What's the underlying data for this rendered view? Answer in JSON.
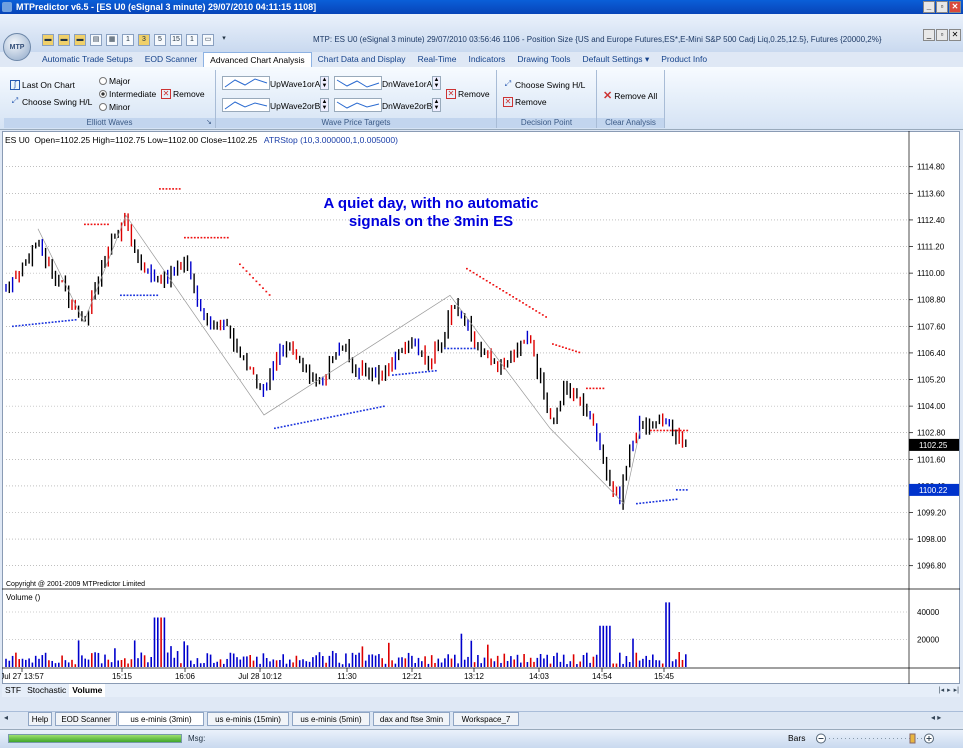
{
  "window": {
    "title": "MTPredictor v6.5 - [ES U0 (eSignal 3 minute) 29/07/2010 04:11:15 1108]",
    "minimize": "_",
    "restore": "▫",
    "close": "✕"
  },
  "app": {
    "orb_label": "MTP",
    "quick_access": [
      "1",
      "3",
      "5",
      "15",
      "1"
    ],
    "info": "MTP: ES U0 (eSignal 3 minute) 29/07/2010 03:56:46 1106 - Position Size {US and Europe Futures,ES*,E-Mini S&P 500 Cadj Liq,0.25,12.5}, Futures {20000,2%}"
  },
  "ribbon_tabs": [
    "Automatic Trade Setups",
    "EOD Scanner",
    "Advanced Chart Analysis",
    "Chart Data and Display",
    "Real-Time",
    "Indicators",
    "Drawing Tools",
    "Default Settings",
    "Product Info"
  ],
  "ribbon": {
    "elliott": {
      "last_on_chart": "Last On Chart",
      "choose_swing": "Choose Swing H/L",
      "major": "Major",
      "intermediate": "Intermediate",
      "minor": "Minor",
      "remove": "Remove",
      "label": "Elliott Waves"
    },
    "wave_targets": {
      "up1": "UpWave1orA",
      "up2": "UpWave2orB",
      "dn1": "DnWave1orA",
      "dn2": "DnWave2orB",
      "remove": "Remove",
      "label": "Wave Price Targets"
    },
    "decision": {
      "choose_swing": "Choose Swing H/L",
      "remove": "Remove",
      "label": "Decision Point"
    },
    "clear": {
      "remove_all": "Remove All",
      "label": "Clear Analysis"
    }
  },
  "chart": {
    "header_symbol": "ES U0",
    "header_ohlc": "Open=1102.25  High=1102.75  Low=1102.00  Close=1102.25",
    "header_indicator": "ATRStop (10,3.000000,1,0.005000)",
    "annotation_line1": "A quiet day, with no automatic",
    "annotation_line2": "signals on the 3min ES",
    "copyright": "Copyright @ 2001-2009 MTPredictor Limited",
    "volume_label": "Volume ()",
    "current_price_label": "1102.25",
    "stop_price_label": "1100.22",
    "colors": {
      "up": "#dd0000",
      "down": "#0000cc",
      "neutral": "#000000",
      "price_tag": "#000000",
      "stop_tag": "#0033cc"
    }
  },
  "chart_data": {
    "type": "candlestick",
    "price_axis_ticks": [
      "1114.80",
      "1113.60",
      "1112.40",
      "1111.20",
      "1110.00",
      "1108.80",
      "1107.60",
      "1106.40",
      "1105.20",
      "1104.00",
      "1102.80",
      "1101.60",
      "1100.40",
      "1099.20",
      "1098.00",
      "1096.80"
    ],
    "volume_axis_ticks": [
      "40000",
      "20000"
    ],
    "time_axis_ticks": [
      "Jul 27 13:57",
      "15:15",
      "16:06",
      "Jul 28 10:12",
      "11:30",
      "12:21",
      "13:12",
      "14:03",
      "14:54",
      "15:45"
    ],
    "ylim": [
      1096.2,
      1115.6
    ],
    "price_path": [
      [
        0,
        1109.2
      ],
      [
        10,
        1109.8
      ],
      [
        22,
        1110.5
      ],
      [
        32,
        1111.4
      ],
      [
        42,
        1110.6
      ],
      [
        55,
        1109.6
      ],
      [
        70,
        1108.6
      ],
      [
        80,
        1107.8
      ],
      [
        95,
        1109.8
      ],
      [
        110,
        1111.6
      ],
      [
        122,
        1112.4
      ],
      [
        132,
        1110.8
      ],
      [
        145,
        1109.8
      ],
      [
        160,
        1109.6
      ],
      [
        175,
        1110.6
      ],
      [
        185,
        1110.2
      ],
      [
        195,
        1108.4
      ],
      [
        208,
        1107.6
      ],
      [
        220,
        1108.0
      ],
      [
        232,
        1106.6
      ],
      [
        246,
        1105.6
      ],
      [
        260,
        1104.6
      ],
      [
        272,
        1106.2
      ],
      [
        286,
        1106.6
      ],
      [
        300,
        1106.0
      ],
      [
        312,
        1104.8
      ],
      [
        325,
        1105.8
      ],
      [
        338,
        1106.8
      ],
      [
        352,
        1105.6
      ],
      [
        368,
        1105.6
      ],
      [
        382,
        1105.4
      ],
      [
        396,
        1106.6
      ],
      [
        410,
        1106.8
      ],
      [
        422,
        1106.0
      ],
      [
        436,
        1106.6
      ],
      [
        448,
        1108.6
      ],
      [
        460,
        1108.0
      ],
      [
        472,
        1106.6
      ],
      [
        486,
        1106.0
      ],
      [
        500,
        1105.6
      ],
      [
        512,
        1106.6
      ],
      [
        526,
        1107.2
      ],
      [
        538,
        1104.8
      ],
      [
        548,
        1103.2
      ],
      [
        560,
        1104.8
      ],
      [
        572,
        1104.4
      ],
      [
        584,
        1103.6
      ],
      [
        596,
        1102.4
      ],
      [
        606,
        1100.6
      ],
      [
        616,
        1099.8
      ],
      [
        626,
        1101.8
      ],
      [
        636,
        1103.4
      ],
      [
        648,
        1103.0
      ],
      [
        660,
        1103.4
      ],
      [
        672,
        1102.6
      ],
      [
        683,
        1102.25
      ]
    ],
    "atr_stop_segments": [
      {
        "side": "below",
        "from": [
          8,
          1107.6
        ],
        "to": [
          72,
          1107.9
        ]
      },
      {
        "side": "above",
        "from": [
          80,
          1112.2
        ],
        "to": [
          105,
          1112.2
        ]
      },
      {
        "side": "below",
        "from": [
          116,
          1109.0
        ],
        "to": [
          155,
          1109.0
        ]
      },
      {
        "side": "above",
        "from": [
          155,
          1113.8
        ],
        "to": [
          176,
          1113.8
        ]
      },
      {
        "side": "above",
        "from": [
          180,
          1111.6
        ],
        "to": [
          226,
          1111.6
        ]
      },
      {
        "side": "above",
        "from": [
          235,
          1110.4
        ],
        "to": [
          265,
          1109.0
        ]
      },
      {
        "side": "below",
        "from": [
          270,
          1103.0
        ],
        "to": [
          380,
          1104.0
        ]
      },
      {
        "side": "below",
        "from": [
          388,
          1105.4
        ],
        "to": [
          432,
          1105.6
        ]
      },
      {
        "side": "below",
        "from": [
          440,
          1106.6
        ],
        "to": [
          470,
          1106.6
        ]
      },
      {
        "side": "above",
        "from": [
          462,
          1110.2
        ],
        "to": [
          542,
          1108.0
        ]
      },
      {
        "side": "above",
        "from": [
          548,
          1106.8
        ],
        "to": [
          576,
          1106.4
        ]
      },
      {
        "side": "above",
        "from": [
          582,
          1104.8
        ],
        "to": [
          600,
          1104.8
        ]
      },
      {
        "side": "below",
        "from": [
          632,
          1099.6
        ],
        "to": [
          672,
          1099.8
        ]
      },
      {
        "side": "below",
        "from": [
          672,
          1100.22
        ],
        "to": [
          684,
          1100.22
        ]
      },
      {
        "side": "above",
        "from": [
          646,
          1102.9
        ],
        "to": [
          684,
          1102.9
        ]
      }
    ],
    "volume_max": 48000
  },
  "bottom_tabs": [
    "STF",
    "Stochastic",
    "Volume"
  ],
  "workspace_tabs": [
    "Help",
    "EOD Scanner",
    "us e-minis (3min)",
    "us e-minis (15min)",
    "us e-minis (5min)",
    "dax and ftse 3min",
    "Workspace_7"
  ],
  "status": {
    "msg_label": "Msg:",
    "bars_label": "Bars"
  }
}
